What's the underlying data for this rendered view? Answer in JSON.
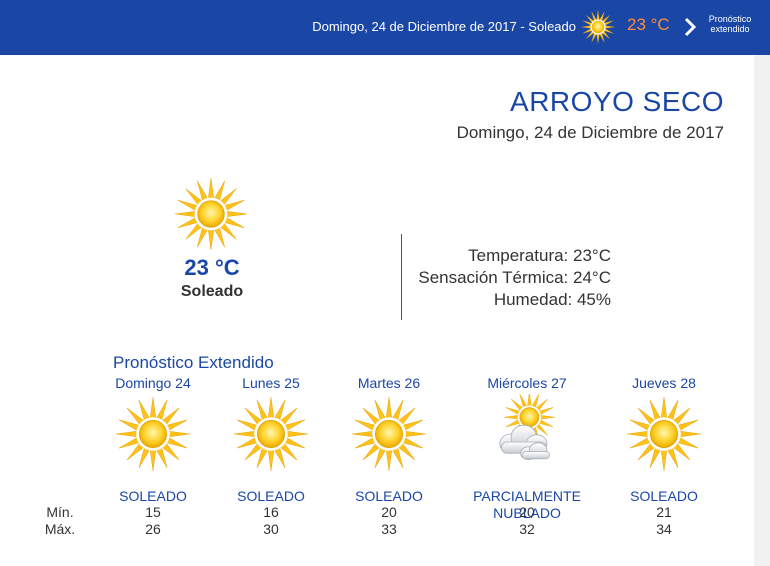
{
  "topbar": {
    "summary": "Domingo, 24 de Diciembre de 2017 - Soleado",
    "temp": "23 °C",
    "extended_link": "Pronóstico extendido",
    "icon": "sun-icon",
    "temp_color": "#ff8a3d",
    "bg_color": "#1a47a6"
  },
  "header": {
    "city": "ARROYO SECO",
    "date": "Domingo, 24 de Diciembre de 2017"
  },
  "current": {
    "icon": "sun-icon",
    "temp": "23 °C",
    "condition": "Soleado",
    "temperature_line": "Temperatura: 23°C",
    "feels_like_line": "Sensación Térmica: 24°C",
    "humidity_line": "Humedad: 45%"
  },
  "extended": {
    "title": "Pronóstico Extendido",
    "min_label": "Mín.",
    "max_label": "Máx.",
    "days": [
      {
        "name": "Domingo 24",
        "icon": "sun-icon",
        "condition": "SOLEADO",
        "min": "15",
        "max": "26"
      },
      {
        "name": "Lunes 25",
        "icon": "sun-icon",
        "condition": "SOLEADO",
        "min": "16",
        "max": "30"
      },
      {
        "name": "Martes 26",
        "icon": "sun-icon",
        "condition": "SOLEADO",
        "min": "20",
        "max": "33"
      },
      {
        "name": "Miércoles 27",
        "icon": "partly-cloudy-icon",
        "condition": "PARCIALMENTE NUBLADO",
        "min": "20",
        "max": "32"
      },
      {
        "name": "Jueves 28",
        "icon": "sun-icon",
        "condition": "SOLEADO",
        "min": "21",
        "max": "34"
      }
    ]
  }
}
